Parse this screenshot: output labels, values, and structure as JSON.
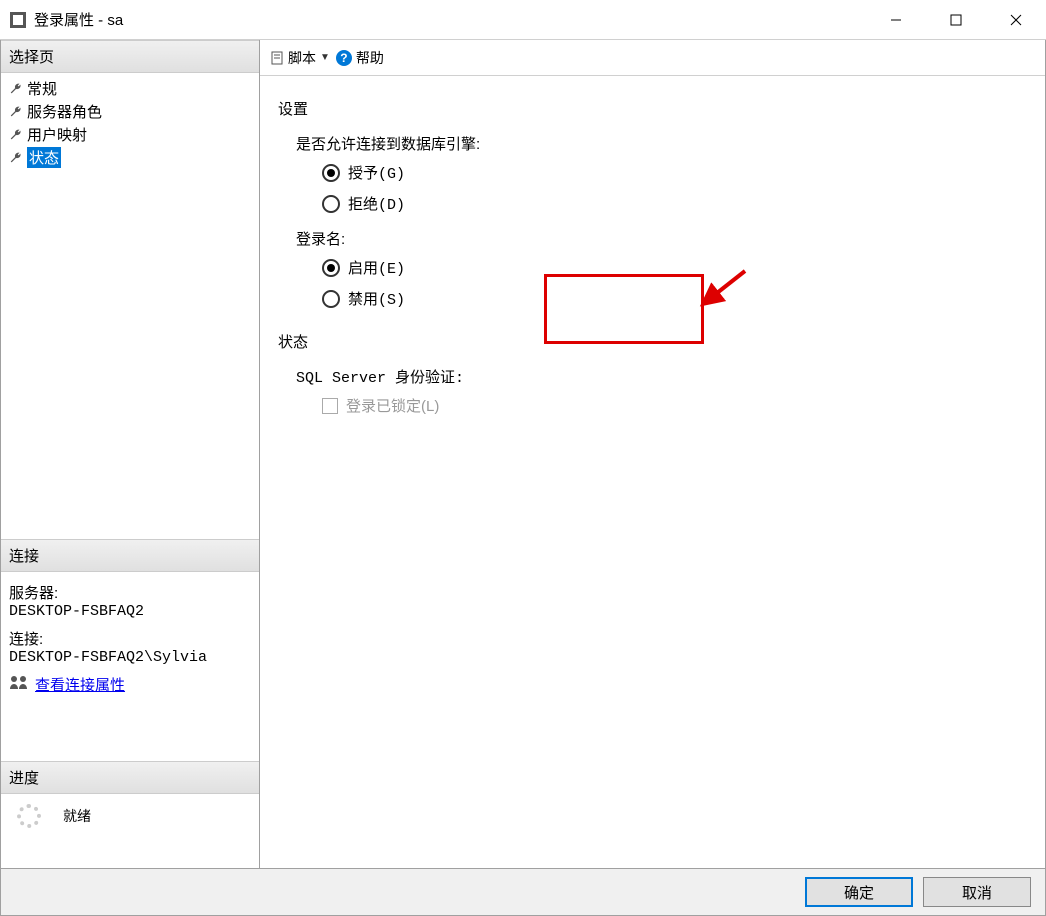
{
  "titlebar": {
    "title": "登录属性 - sa"
  },
  "left_panel": {
    "select_page_header": "选择页",
    "nav_items": [
      {
        "label": "常规"
      },
      {
        "label": "服务器角色"
      },
      {
        "label": "用户映射"
      },
      {
        "label": "状态"
      }
    ],
    "connection_header": "连接",
    "server_label": "服务器:",
    "server_value": "DESKTOP-FSBFAQ2",
    "conn_label": "连接:",
    "conn_value": "DESKTOP-FSBFAQ2\\Sylvia",
    "view_props_link": "查看连接属性",
    "progress_header": "进度",
    "progress_status": "就绪"
  },
  "toolbar": {
    "script_label": "脚本",
    "help_label": "帮助"
  },
  "main": {
    "settings_title": "设置",
    "db_engine_label": "是否允许连接到数据库引擎:",
    "grant_label": "授予(G)",
    "deny_label": "拒绝(D)",
    "login_label": "登录名:",
    "enable_label": "启用(E)",
    "disable_label": "禁用(S)",
    "status_title": "状态",
    "sql_auth_label": "SQL Server 身份验证:",
    "locked_label": "登录已锁定(L)"
  },
  "footer": {
    "ok_label": "确定",
    "cancel_label": "取消"
  }
}
